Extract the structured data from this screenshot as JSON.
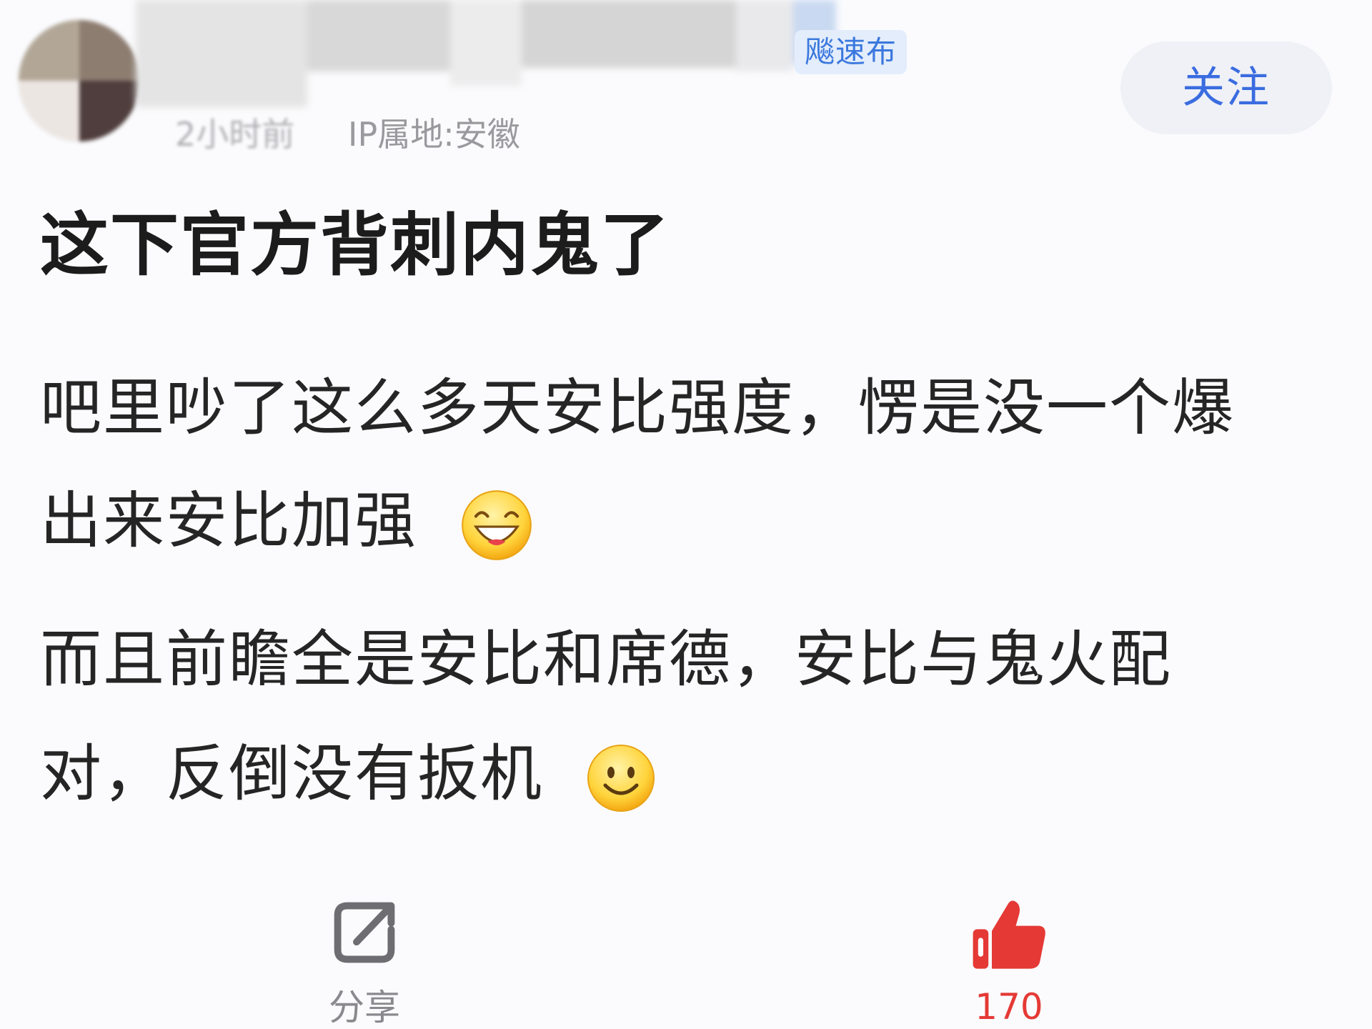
{
  "author": {
    "badge": "飚速布",
    "time": "2小时前",
    "ip_location": "IP属地:安徽",
    "follow_label": "关注"
  },
  "post": {
    "title": "这下官方背刺内鬼了",
    "lines": [
      "吧里吵了这么多天安比强度，愣是没一个爆",
      "出来安比加强",
      "而且前瞻全是安比和席德，安比与鬼火配",
      "对，反倒没有扳机"
    ],
    "emojis": [
      "laughing-emoji",
      "smile-emoji"
    ]
  },
  "actions": {
    "share_label": "分享",
    "like_count": "170",
    "like_color": "#e53935"
  }
}
